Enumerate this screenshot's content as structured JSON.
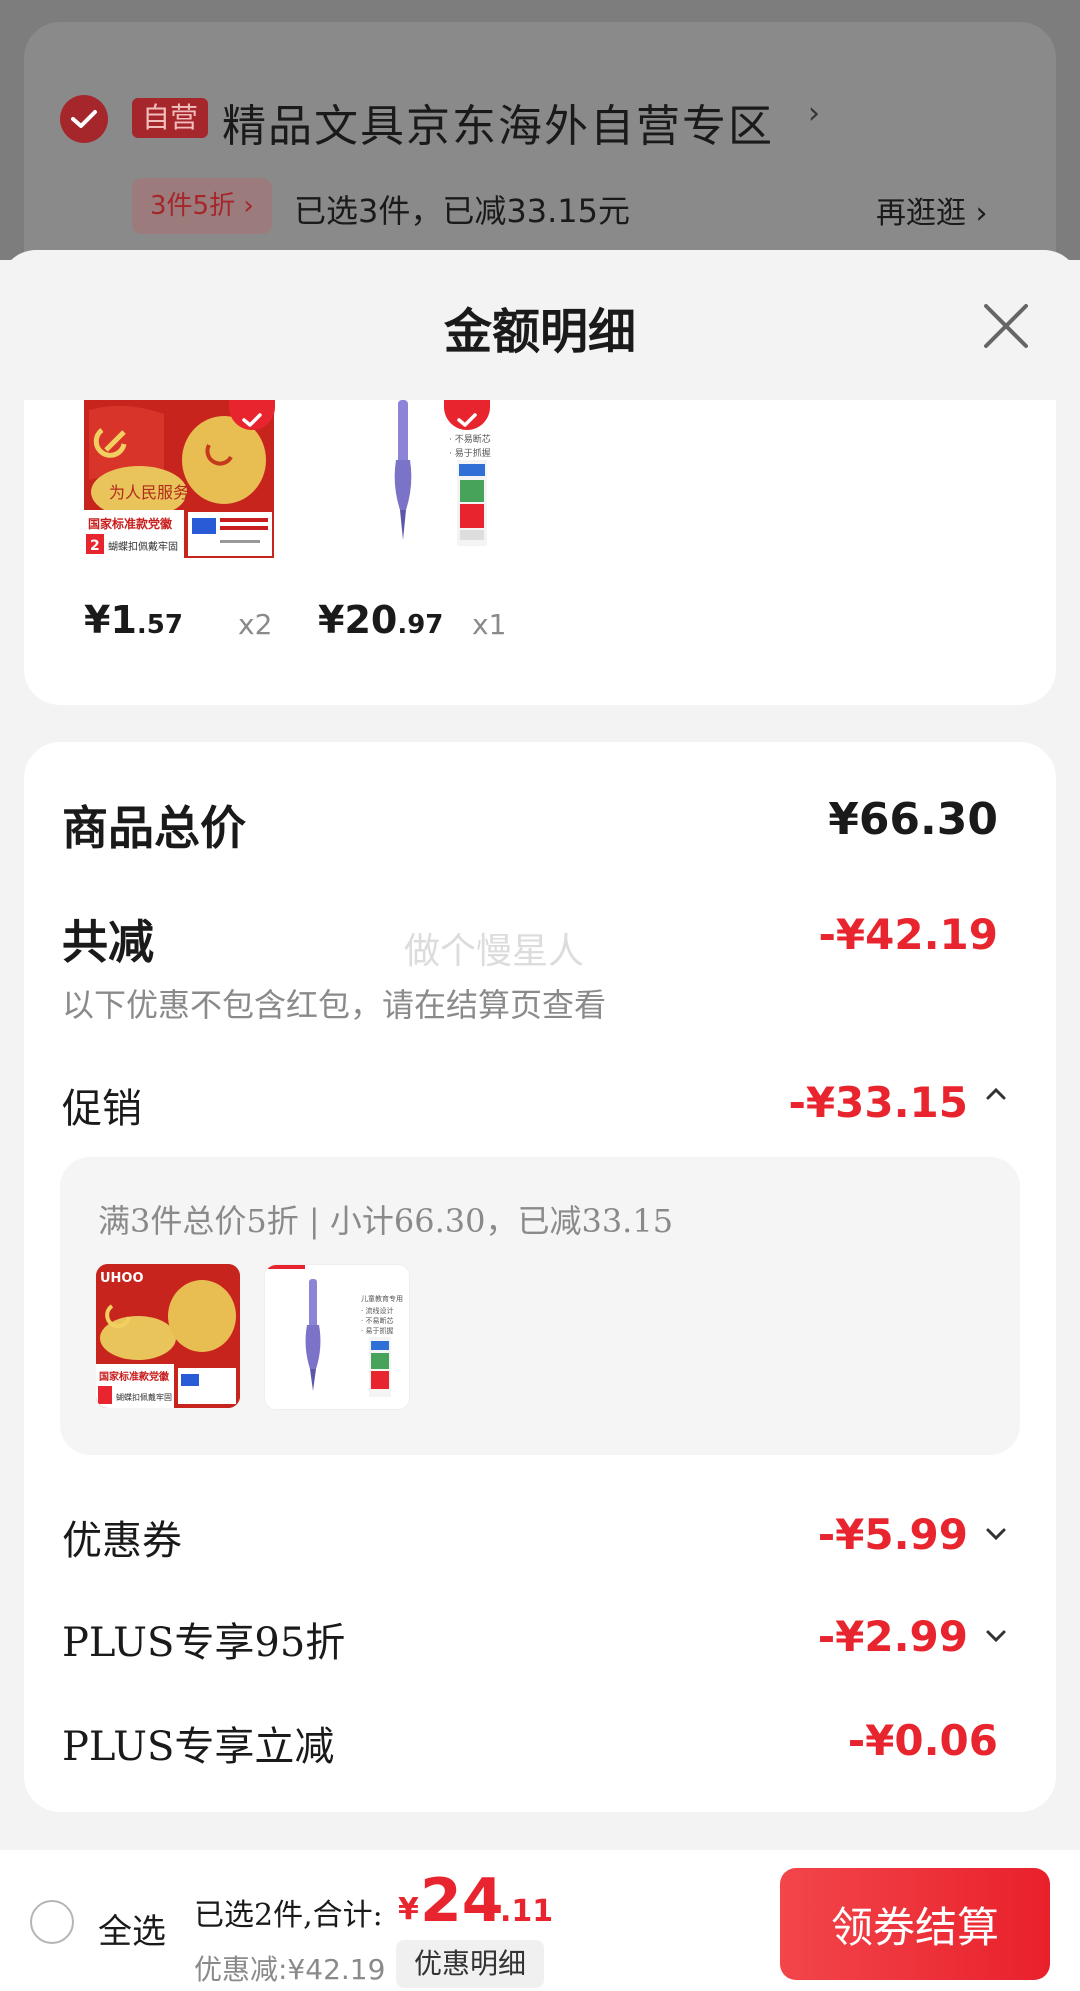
{
  "store": {
    "self_badge": "自营",
    "name": "精品文具京东海外自营专区",
    "chevron": "›",
    "promo_tag": "3件5折 ›",
    "promo_text": "已选3件，已减33.15元",
    "browse_link": "再逛逛 ›"
  },
  "sheet": {
    "title": "金额明细"
  },
  "products": [
    {
      "price_int": "¥1",
      "price_dec": ".57",
      "qty": "x2"
    },
    {
      "price_int": "¥20",
      "price_dec": ".97",
      "qty": "x1"
    }
  ],
  "details": {
    "total_label": "商品总价",
    "total_value": "¥66.30",
    "reduce_label": "共减",
    "reduce_value": "-¥42.19",
    "reduce_note": "以下优惠不包含红包，请在结算页查看",
    "watermark": "做个慢星人",
    "promo_label": "促销",
    "promo_value": "-¥33.15",
    "promo_detail": "满3件总价5折 | 小计66.30，已减33.15",
    "coupon_label": "优惠券",
    "coupon_value": "-¥5.99",
    "plus95_label": "PLUS专享95折",
    "plus95_value": "-¥2.99",
    "plusoff_label": "PLUS专享立减",
    "plusoff_value": "-¥0.06"
  },
  "bottom": {
    "select_all": "全选",
    "summary": "已选2件,合计:",
    "total_symbol": "¥",
    "total_int": "24",
    "total_dec": ".11",
    "discount": "优惠减:¥42.19",
    "detail_button": "优惠明细",
    "checkout_button": "领券结算"
  },
  "colors": {
    "accent_red": "#e8252e",
    "text_dark": "#1a1a1a",
    "text_gray": "#8a8a8a"
  }
}
